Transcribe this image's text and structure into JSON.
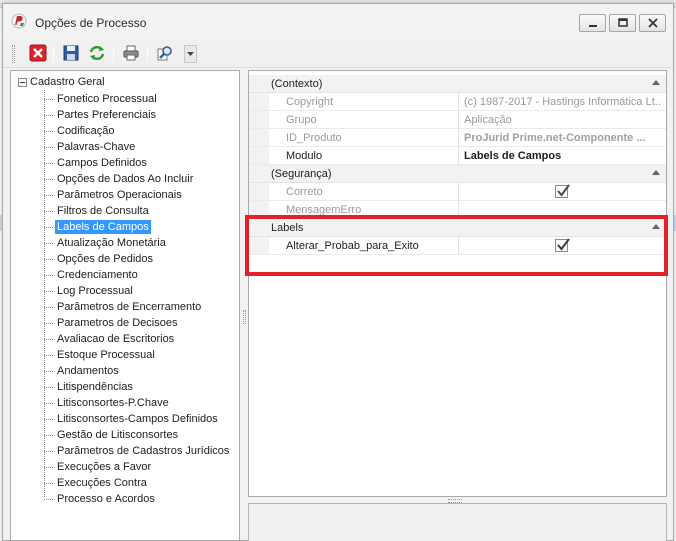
{
  "window": {
    "title": "Opções de Processo",
    "controls": {
      "minimize": "minimize",
      "maximize": "maximize",
      "close": "close"
    }
  },
  "toolbar": {
    "buttons": [
      {
        "icon": "close-red-x-icon"
      },
      {
        "icon": "save-disk-icon"
      },
      {
        "icon": "refresh-green-icon"
      },
      {
        "icon": "print-icon"
      },
      {
        "icon": "find-magnifier-icon"
      }
    ]
  },
  "tree": {
    "root": "Cadastro Geral",
    "items": [
      "Fonetico Processual",
      "Partes Preferenciais",
      "Codificação",
      "Palavras-Chave",
      "Campos Definidos",
      "Opções de Dados Ao Incluir",
      "Parâmetros Operacionais",
      "Filtros de Consulta",
      "Labels de Campos",
      "Atualização Monetária",
      "Opções de Pedidos",
      "Credenciamento",
      "Log Processual",
      "Parâmetros de Encerramento",
      "Parametros de Decisoes",
      "Avaliacao de Escritorios",
      "Estoque Processual",
      "Andamentos",
      "Litispendências",
      "Litisconsortes-P.Chave",
      "Litisconsortes-Campos Definidos",
      "Gestão de Litisconsortes",
      "Parâmetros de Cadastros Jurídicos",
      "Execuções a Favor",
      "Execuções Contra",
      "Processo e Acordos"
    ],
    "selected_index": 8
  },
  "property_grid": {
    "categories": {
      "contexto": "(Contexto)",
      "seguranca": "(Segurança)",
      "labels": "Labels"
    },
    "contexto": {
      "copyright": {
        "name": "Copyright",
        "value": "(c) 1987-2017 - Hastings Informática Lt..."
      },
      "grupo": {
        "name": "Grupo",
        "value": "Aplicação"
      },
      "id_produto": {
        "name": "ID_Produto",
        "value": "ProJurid Prime.net-Componente ..."
      },
      "modulo": {
        "name": "Modulo",
        "value": "Labels de Campos"
      }
    },
    "seguranca": {
      "correto": {
        "name": "Correto",
        "checked": true
      },
      "mensagem_erro": {
        "name": "MensagemErro",
        "value": ""
      }
    },
    "labels": {
      "alterar": {
        "name": "Alterar_Probab_para_Exito",
        "checked": true
      }
    }
  },
  "highlight_color": "#e5202a",
  "selection_color": "#3399ff"
}
